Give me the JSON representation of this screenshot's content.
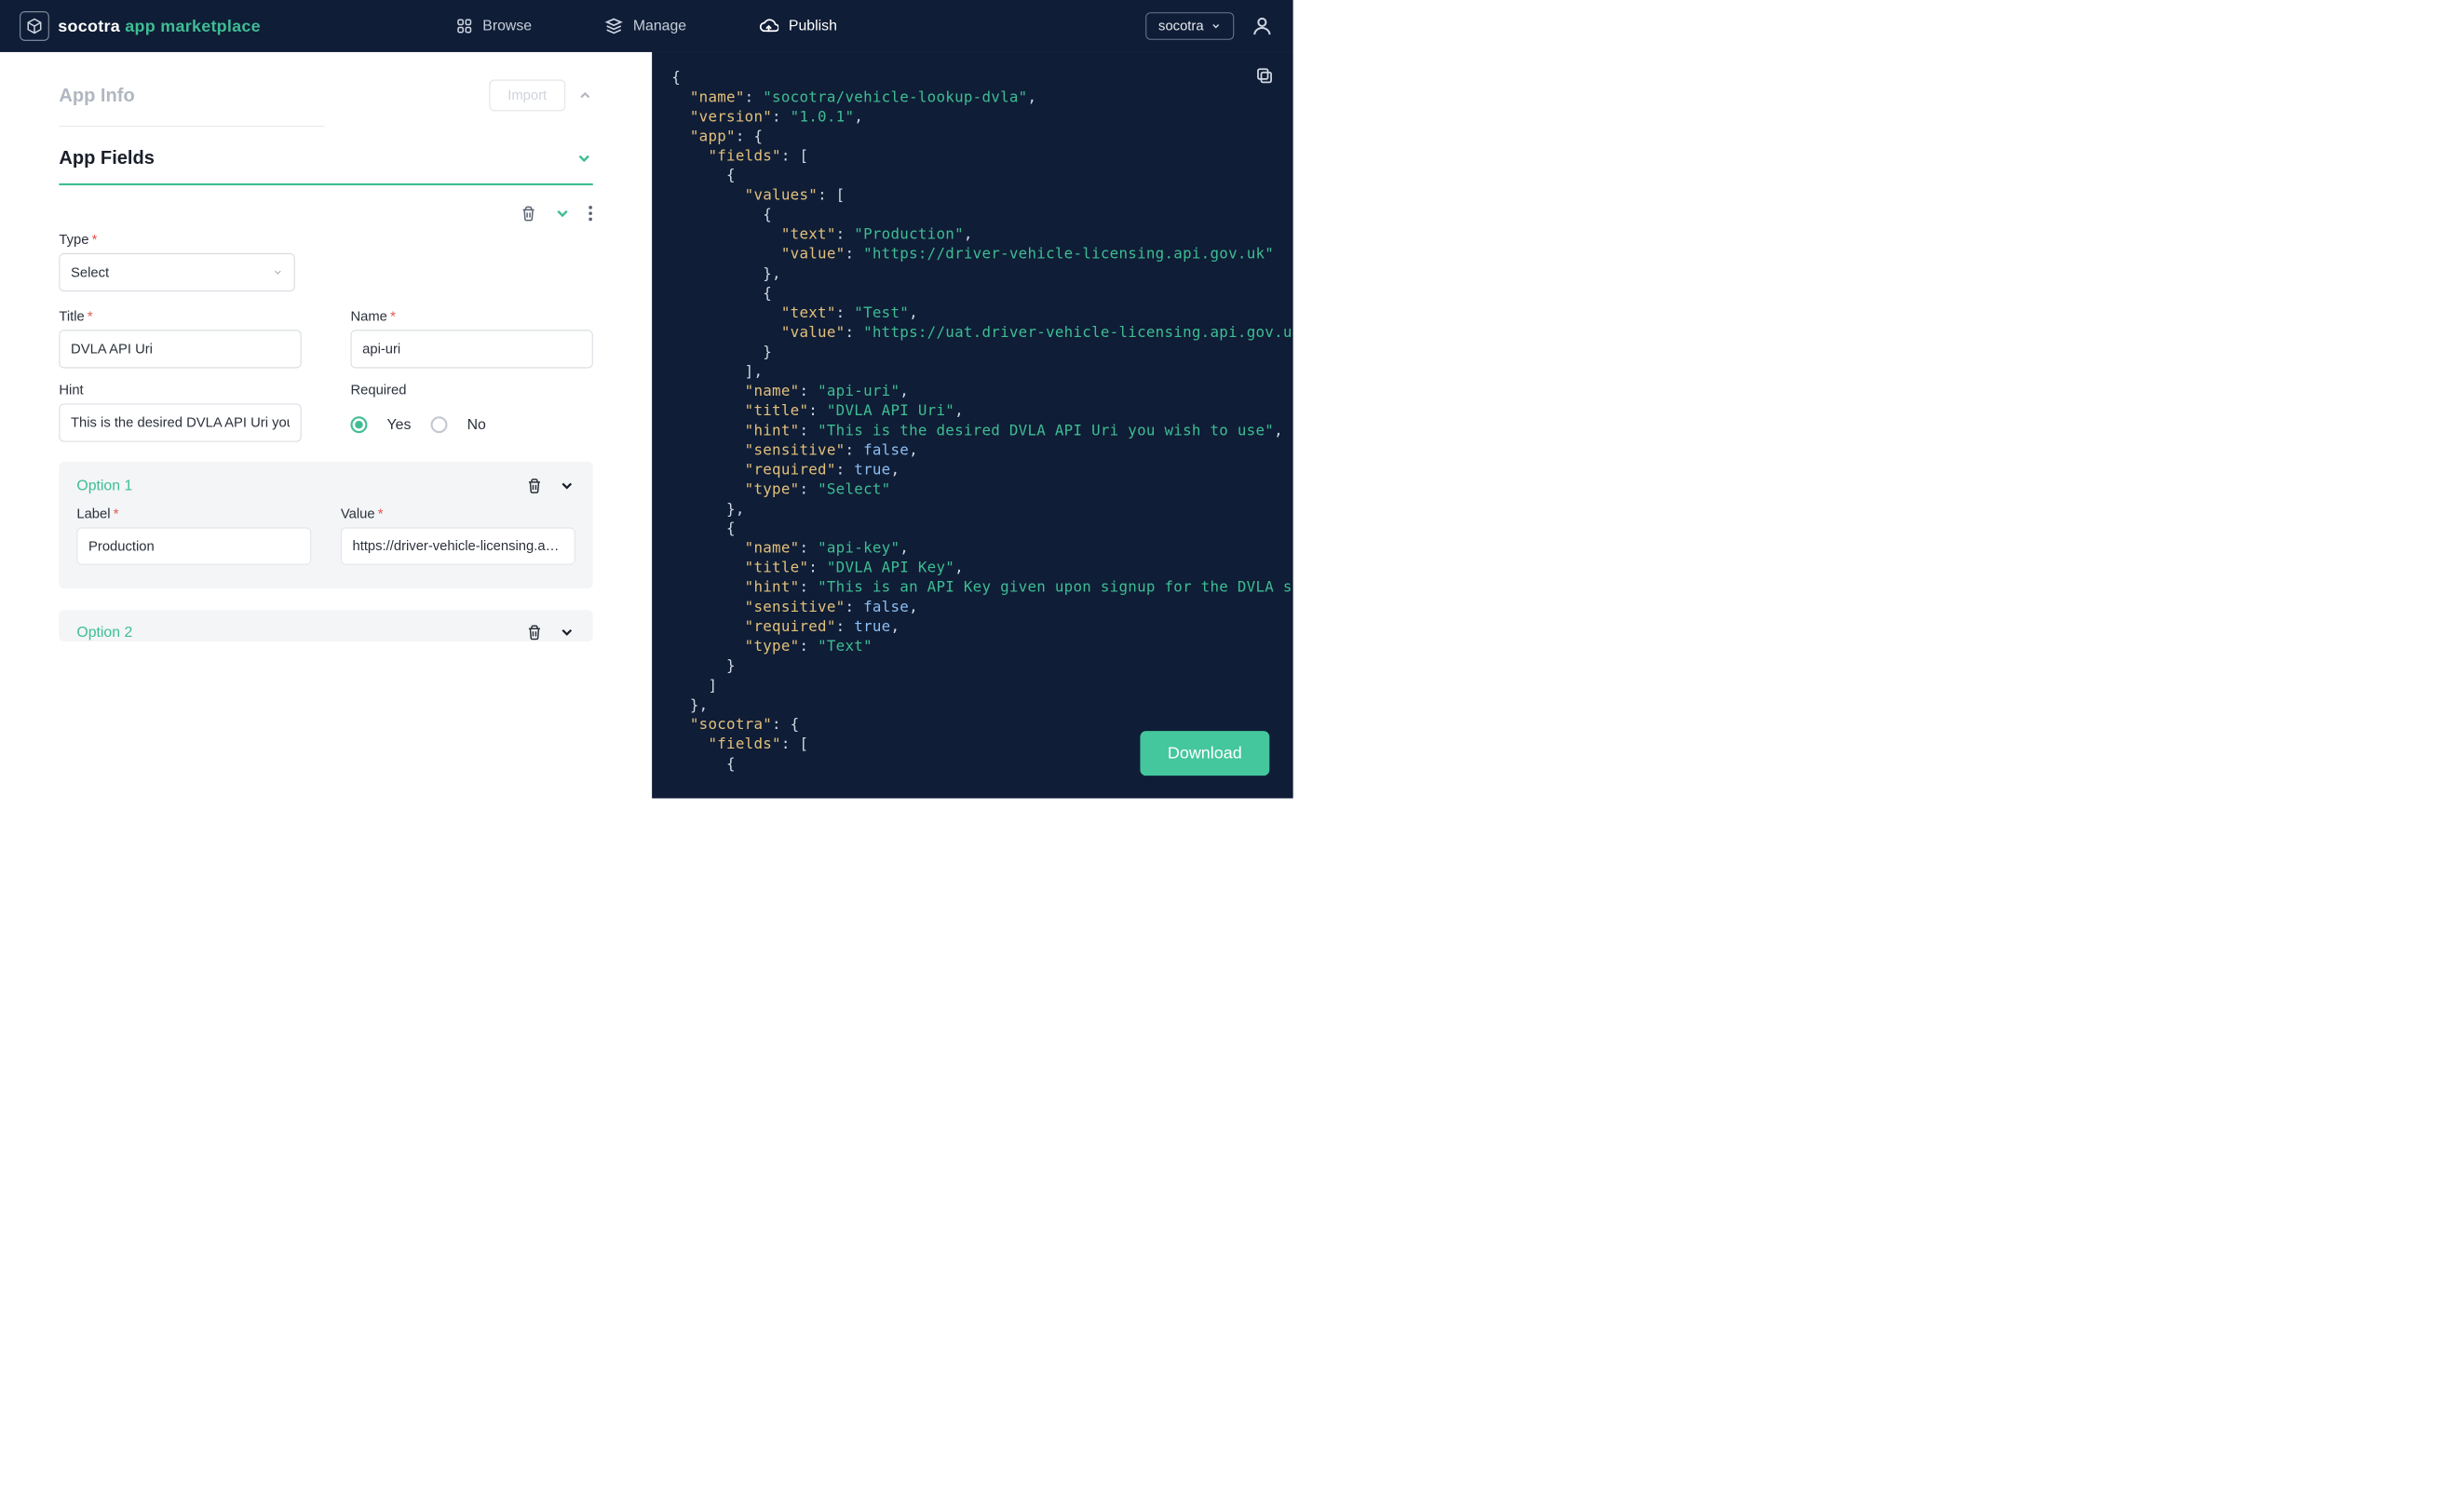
{
  "header": {
    "brand_primary": "socotra",
    "brand_secondary": "app marketplace",
    "nav": {
      "browse": "Browse",
      "manage": "Manage",
      "publish": "Publish"
    },
    "tenant": "socotra"
  },
  "left": {
    "app_info": {
      "title": "App Info",
      "import_label": "Import"
    },
    "app_fields": {
      "title": "App Fields"
    },
    "field_form": {
      "type_label": "Type",
      "type_value": "Select",
      "title_label": "Title",
      "title_value": "DVLA API Uri",
      "name_label": "Name",
      "name_value": "api-uri",
      "hint_label": "Hint",
      "hint_value": "This is the desired DVLA API Uri you wish to use",
      "required_label": "Required",
      "required_yes": "Yes",
      "required_no": "No"
    },
    "option1": {
      "title": "Option 1",
      "label_label": "Label",
      "label_value": "Production",
      "value_label": "Value",
      "value_value": "https://driver-vehicle-licensing.api.gov.uk"
    },
    "option2": {
      "title": "Option 2"
    }
  },
  "right": {
    "download_label": "Download",
    "json": {
      "name": "socotra/vehicle-lookup-dvla",
      "version": "1.0.1",
      "app": {
        "fields": [
          {
            "values": [
              {
                "text": "Production",
                "value": "https://driver-vehicle-licensing.api.gov.uk"
              },
              {
                "text": "Test",
                "value": "https://uat.driver-vehicle-licensing.api.gov.uk"
              }
            ],
            "name": "api-uri",
            "title": "DVLA API Uri",
            "hint": "This is the desired DVLA API Uri you wish to use",
            "sensitive": false,
            "required": true,
            "type": "Select"
          },
          {
            "name": "api-key",
            "title": "DVLA API Key",
            "hint": "This is an API Key given upon signup for the DVLA service",
            "sensitive": false,
            "required": true,
            "type": "Text"
          }
        ]
      },
      "socotra": {
        "fields_open": true
      }
    }
  }
}
